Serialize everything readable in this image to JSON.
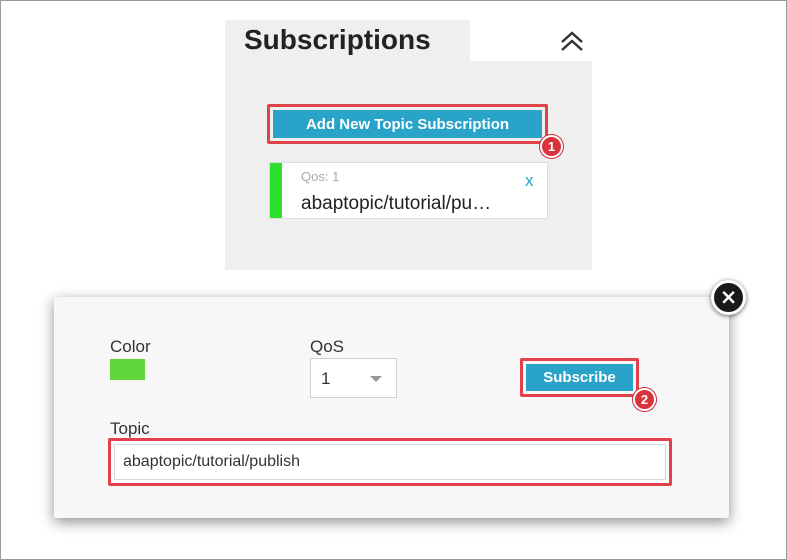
{
  "subscriptions": {
    "title": "Subscriptions",
    "add_button_label": "Add New Topic Subscription",
    "items": [
      {
        "qos_label": "Qos: 1",
        "topic": "abaptopic/tutorial/pu…",
        "remove_label": "x",
        "color": "#2ee02e"
      }
    ]
  },
  "dialog": {
    "color_label": "Color",
    "color_value": "#5fd63a",
    "qos_label": "QoS",
    "qos_selected": "1",
    "subscribe_label": "Subscribe",
    "topic_label": "Topic",
    "topic_value": "abaptopic/tutorial/publish",
    "close_label": "×"
  },
  "markers": {
    "first": "1",
    "second": "2"
  },
  "colors": {
    "accent": "#2aa3c9",
    "highlight": "#e0414a",
    "marker": "#d9333c"
  }
}
